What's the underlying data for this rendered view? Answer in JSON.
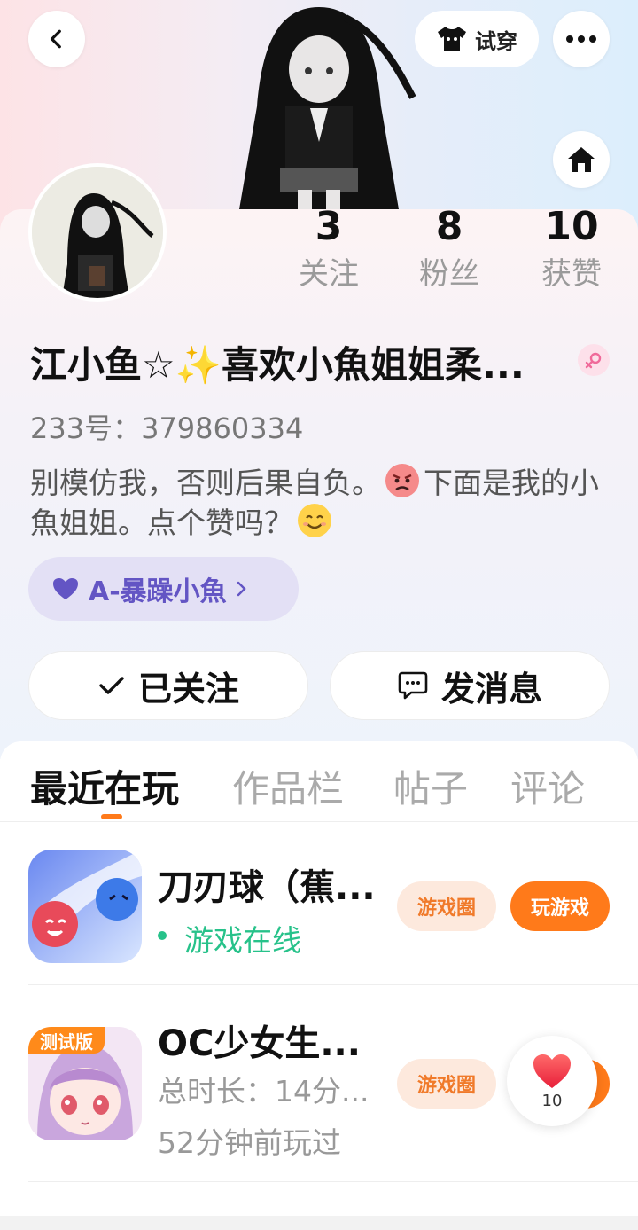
{
  "header": {
    "try_on_label": "试穿"
  },
  "stats": [
    {
      "value": "3",
      "label": "关注"
    },
    {
      "value": "8",
      "label": "粉丝"
    },
    {
      "value": "10",
      "label": "获赞"
    }
  ],
  "profile": {
    "username": "江小鱼☆✨喜欢小魚姐姐柔...",
    "uid": "233号：379860334",
    "bio_part1": "别模仿我，否则后果自负。",
    "bio_part2": "下面是我的小魚姐姐。点个赞吗？",
    "tag_label": "A-暴躁小魚"
  },
  "actions": {
    "followed_label": "已关注",
    "message_label": "发消息"
  },
  "tabs": [
    {
      "label": "最近在玩"
    },
    {
      "label": "作品栏"
    },
    {
      "label": "帖子"
    },
    {
      "label": "评论"
    }
  ],
  "games": [
    {
      "title": "刀刃球（蕉...",
      "status": "游戏在线",
      "circle_label": "游戏圈",
      "play_label": "玩游戏"
    },
    {
      "title": "OC少女生...",
      "duration": "总时长：14分...",
      "last_played": "52分钟前玩过",
      "circle_label": "游戏圈",
      "badge": "测试版"
    }
  ],
  "like_float": {
    "count": "10"
  },
  "colors": {
    "accent": "#ff7a1a",
    "online": "#27c28a",
    "tag_text": "#6355c4"
  }
}
